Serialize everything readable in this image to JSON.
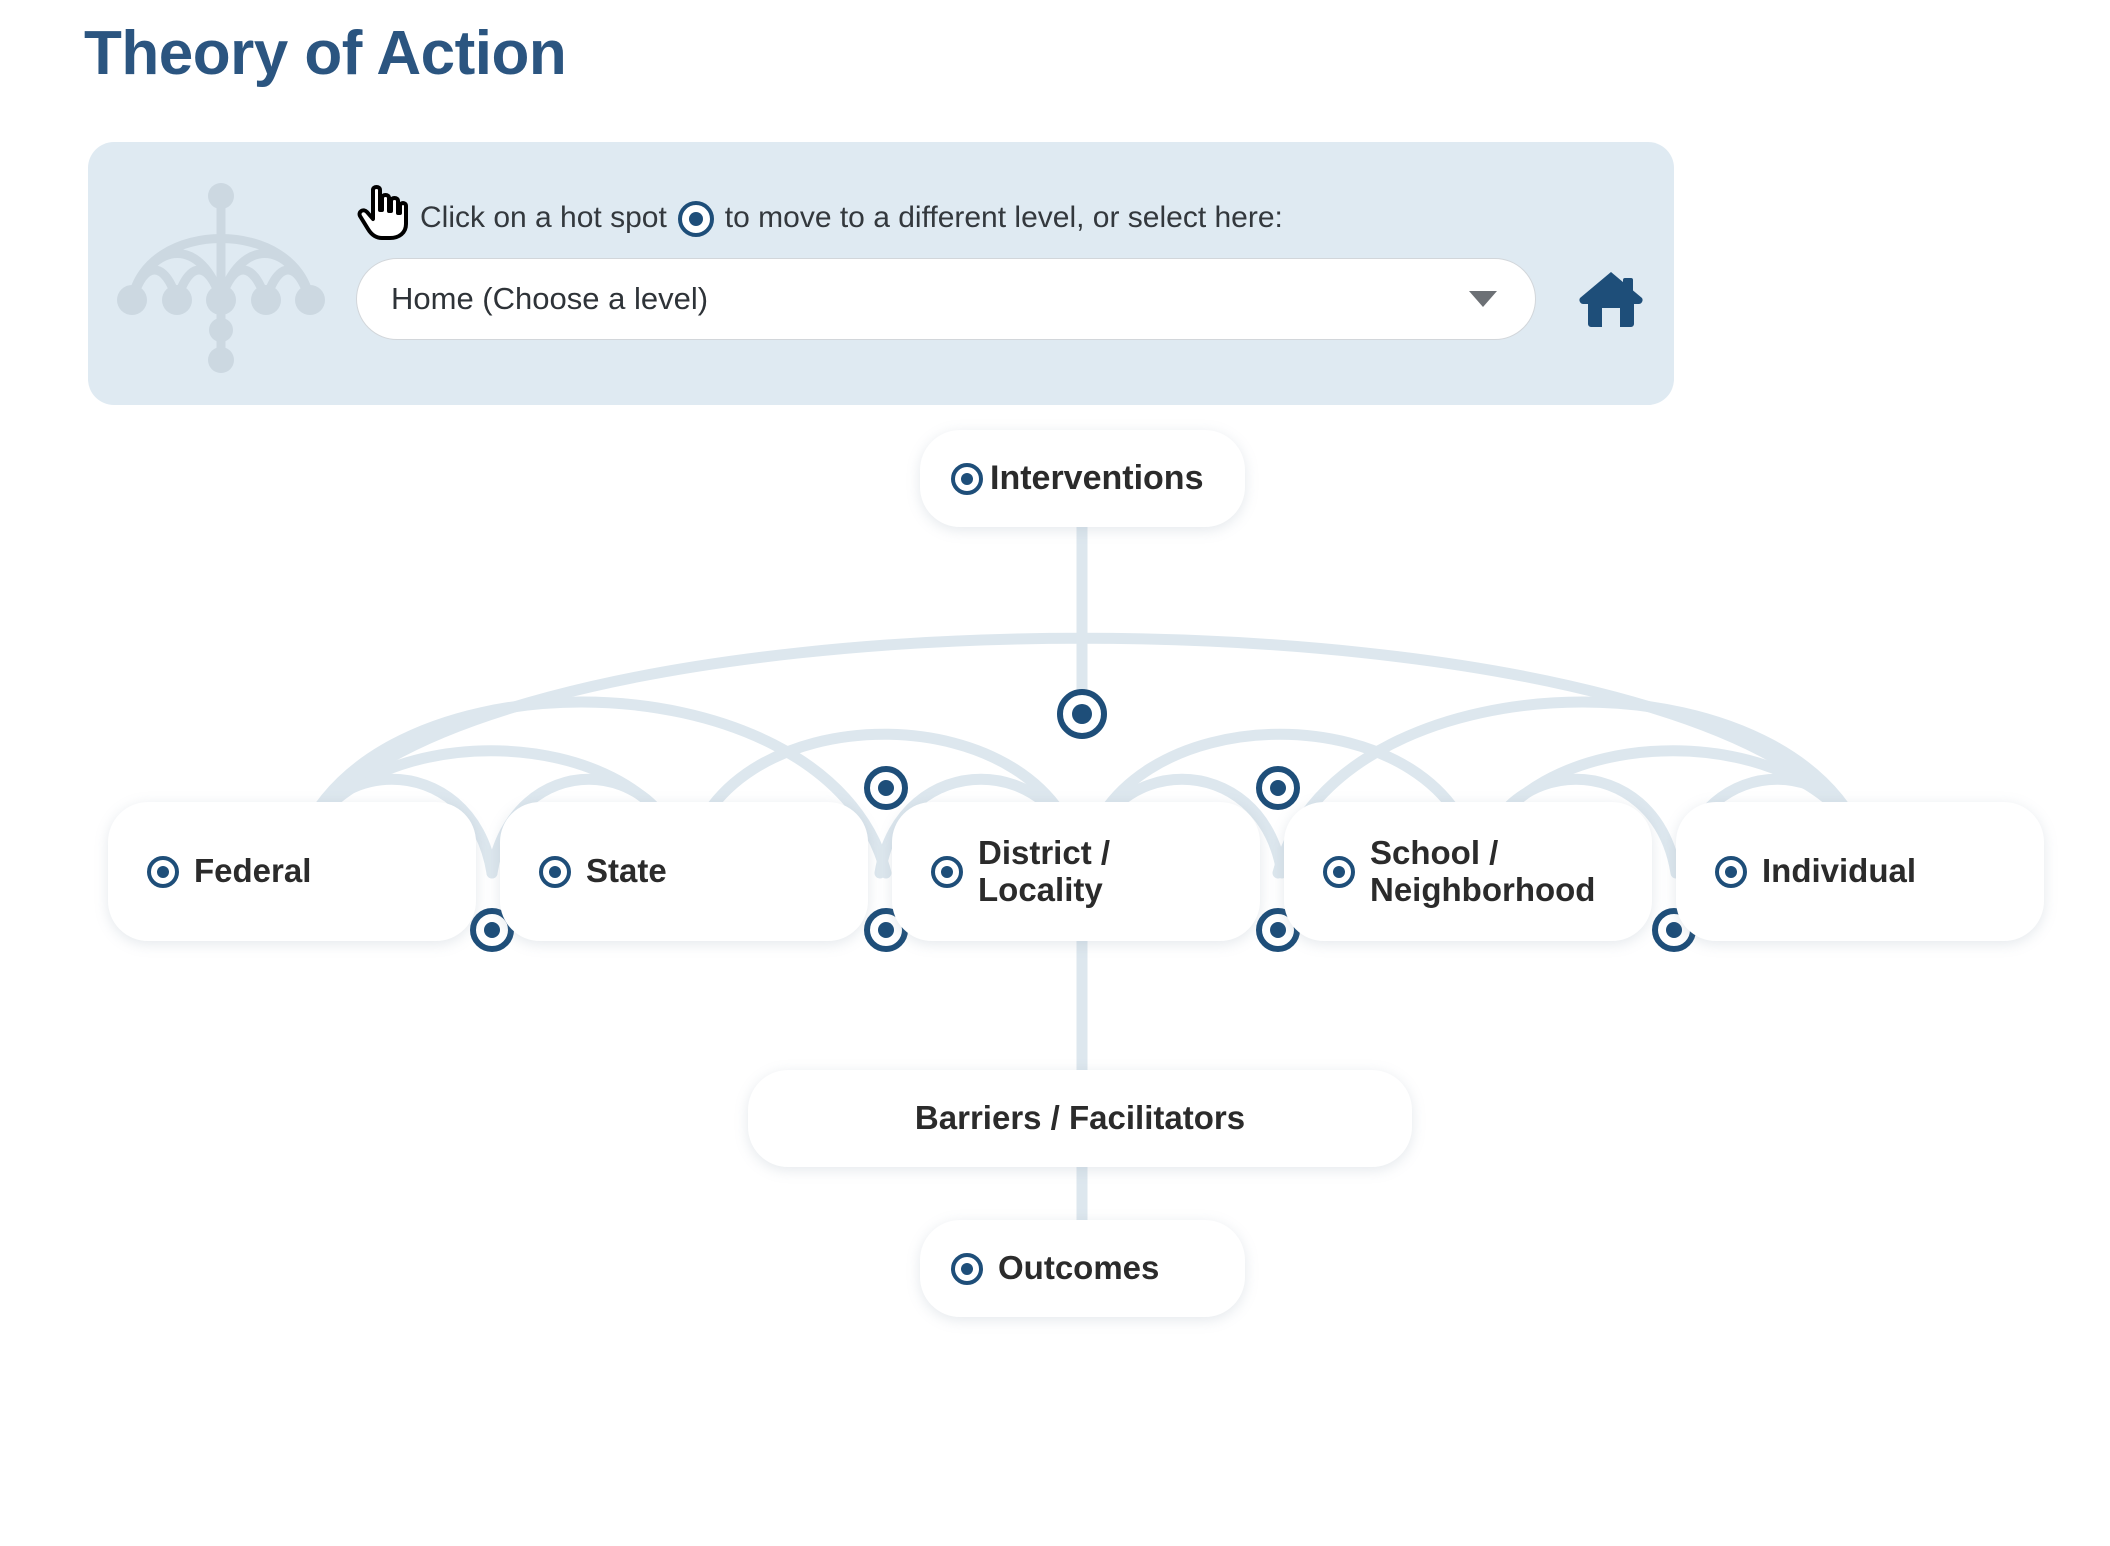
{
  "page": {
    "title": "Theory of Action",
    "title_color": "#2b5580"
  },
  "control_panel": {
    "logo_icon": "umbrella-network-icon",
    "cursor_icon": "pointing-hand-cursor-icon",
    "hotspot_icon": "hot-spot-icon",
    "instruction_before": "Click on a hot spot",
    "instruction_after": "to move to a different level, or select here:",
    "select": {
      "value": "Home (Choose a level)",
      "placeholder": "Home (Choose a level)",
      "caret_icon": "chevron-down-icon",
      "options": [
        "Home (Choose a level)",
        "Interventions",
        "Federal",
        "State",
        "District / Locality",
        "School / Neighborhood",
        "Individual",
        "Outcomes"
      ]
    },
    "home_button": {
      "icon": "home-icon",
      "label": "Home"
    },
    "background_color": "#dfeaf2"
  },
  "diagram": {
    "accent_color": "#1e4e79",
    "arc_color": "#dde7ee",
    "nodes": {
      "interventions": {
        "label": "Interventions",
        "hotspot": true
      },
      "federal": {
        "label": "Federal",
        "hotspot": true
      },
      "state": {
        "label": "State",
        "hotspot": true
      },
      "district": {
        "label": "District /\nLocality",
        "hotspot": true
      },
      "school": {
        "label": "School /\nNeighborhood",
        "hotspot": true
      },
      "individual": {
        "label": "Individual",
        "hotspot": true
      },
      "barriers": {
        "label": "Barriers / Facilitators",
        "hotspot": false
      },
      "outcomes": {
        "label": "Outcomes",
        "hotspot": true
      }
    },
    "hotspot_count": 10
  }
}
